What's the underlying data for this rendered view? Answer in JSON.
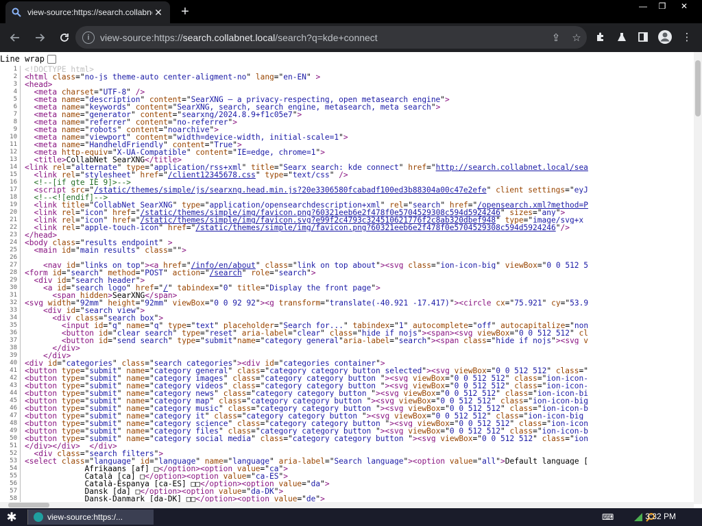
{
  "browser": {
    "tab_title": "view-source:https://search.collabnet...",
    "url_scheme": "view-source:https://",
    "url_host": "search.collabnet.local",
    "url_path": "/search?q=kde+connect",
    "url_full": "view-source:https://search.collabnet.local/search?q=kde+connect"
  },
  "line_wrap_label": "Line wrap",
  "source_lines": [
    {
      "n": "1",
      "html": "<span class='t-doc'>&lt;!DOCTYPE html&gt;</span>"
    },
    {
      "n": "2",
      "html": "<span class='t-tag'>&lt;html</span> <span class='t-attr'>class</span>=\"<span class='t-val'>no-js theme-auto center-aligment-no</span>\" <span class='t-attr'>lang</span>=\"<span class='t-val'>en-EN</span>\" <span class='t-tag'>&gt;</span>"
    },
    {
      "n": "3",
      "html": "<span class='t-tag'>&lt;head&gt;</span>"
    },
    {
      "n": "4",
      "html": "  <span class='t-tag'>&lt;meta</span> <span class='t-attr'>charset</span>=\"<span class='t-val'>UTF-8</span>\" <span class='t-tag'>/&gt;</span>"
    },
    {
      "n": "5",
      "html": "  <span class='t-tag'>&lt;meta</span> <span class='t-attr'>name</span>=\"<span class='t-val'>description</span>\" <span class='t-attr'>content</span>=\"<span class='t-val'>SearXNG — a privacy-respecting, open metasearch engine</span>\"<span class='t-tag'>&gt;</span>"
    },
    {
      "n": "6",
      "html": "  <span class='t-tag'>&lt;meta</span> <span class='t-attr'>name</span>=\"<span class='t-val'>keywords</span>\" <span class='t-attr'>content</span>=\"<span class='t-val'>SearXNG, search, search engine, metasearch, meta search</span>\"<span class='t-tag'>&gt;</span>"
    },
    {
      "n": "7",
      "html": "  <span class='t-tag'>&lt;meta</span> <span class='t-attr'>name</span>=\"<span class='t-val'>generator</span>\" <span class='t-attr'>content</span>=\"<span class='t-val'>searxng/2024.8.9+f1c05e7</span>\"<span class='t-tag'>&gt;</span>"
    },
    {
      "n": "8",
      "html": "  <span class='t-tag'>&lt;meta</span> <span class='t-attr'>name</span>=\"<span class='t-val'>referrer</span>\" <span class='t-attr'>content</span>=\"<span class='t-val'>no-referrer</span>\"<span class='t-tag'>&gt;</span>"
    },
    {
      "n": "9",
      "html": "  <span class='t-tag'>&lt;meta</span> <span class='t-attr'>name</span>=\"<span class='t-val'>robots</span>\" <span class='t-attr'>content</span>=\"<span class='t-val'>noarchive</span>\"<span class='t-tag'>&gt;</span>"
    },
    {
      "n": "10",
      "html": "  <span class='t-tag'>&lt;meta</span> <span class='t-attr'>name</span>=\"<span class='t-val'>viewport</span>\" <span class='t-attr'>content</span>=\"<span class='t-val'>width=device-width, initial-scale=1</span>\"<span class='t-tag'>&gt;</span>"
    },
    {
      "n": "11",
      "html": "  <span class='t-tag'>&lt;meta</span> <span class='t-attr'>name</span>=\"<span class='t-val'>HandheldFriendly</span>\" <span class='t-attr'>content</span>=\"<span class='t-val'>True</span>\"<span class='t-tag'>&gt;</span>"
    },
    {
      "n": "12",
      "html": "  <span class='t-tag'>&lt;meta</span> <span class='t-attr'>http-equiv</span>=\"<span class='t-val'>X-UA-Compatible</span>\" <span class='t-attr'>content</span>=\"<span class='t-val'>IE=edge, chrome=1</span>\"<span class='t-tag'>&gt;</span>"
    },
    {
      "n": "13",
      "html": "  <span class='t-tag'>&lt;title&gt;</span>CollabNet SearXNG<span class='t-tag'>&lt;/title&gt;</span>"
    },
    {
      "n": "14",
      "html": "<span class='t-tag'>&lt;link</span> <span class='t-attr'>rel</span>=\"<span class='t-val'>alternate</span>\" <span class='t-attr'>type</span>=\"<span class='t-val'>application/rss+xml</span>\" <span class='t-attr'>title</span>=\"<span class='t-val'>Searx search: kde connect</span>\" <span class='t-attr'>href</span>=\"<span class='t-link'>http://search.collabnet.local/sea</span>"
    },
    {
      "n": "15",
      "html": "  <span class='t-tag'>&lt;link</span> <span class='t-attr'>rel</span>=\"<span class='t-val'>stylesheet</span>\" <span class='t-attr'>href</span>=\"<span class='t-link'>/client12345678.css</span>\" <span class='t-attr'>type</span>=\"<span class='t-val'>text/css</span>\" <span class='t-tag'>/&gt;</span>"
    },
    {
      "n": "16",
      "html": "  <span class='t-com'>&lt;!--[if gte IE 9]&gt;--&gt;</span>"
    },
    {
      "n": "17",
      "html": "  <span class='t-tag'>&lt;script</span> <span class='t-attr'>src</span>=\"<span class='t-link'>/static/themes/simple/js/searxng.head.min.js?20e3306580fcabadf100ed3b88304a00c47e2efe</span>\" <span class='t-attr'>client_settings</span>=\"<span class='t-val'>eyJ</span>"
    },
    {
      "n": "18",
      "html": "  <span class='t-com'>&lt;!--&lt;![endif]--&gt;</span>"
    },
    {
      "n": "19",
      "html": "  <span class='t-tag'>&lt;link</span> <span class='t-attr'>title</span>=\"<span class='t-val'>CollabNet SearXNG</span>\" <span class='t-attr'>type</span>=\"<span class='t-val'>application/opensearchdescription+xml</span>\" <span class='t-attr'>rel</span>=\"<span class='t-val'>search</span>\" <span class='t-attr'>href</span>=\"<span class='t-link'>/opensearch.xml?method=P</span>"
    },
    {
      "n": "20",
      "html": "  <span class='t-tag'>&lt;link</span> <span class='t-attr'>rel</span>=\"<span class='t-val'>icon</span>\" <span class='t-attr'>href</span>=\"<span class='t-link'>/static/themes/simple/img/favicon.png?60321eeb6e2f478f0e5704529308c594d5924246</span>\" <span class='t-attr'>sizes</span>=\"<span class='t-val'>any</span>\"<span class='t-tag'>&gt;</span>"
    },
    {
      "n": "21",
      "html": "  <span class='t-tag'>&lt;link</span> <span class='t-attr'>rel</span>=\"<span class='t-val'>icon</span>\" <span class='t-attr'>href</span>=\"<span class='t-link'>/static/themes/simple/img/favicon.svg?e99f2c4793c324510621776f2c8ab320dbef948</span>\" <span class='t-attr'>type</span>=\"<span class='t-val'>image/svg+x</span>"
    },
    {
      "n": "22",
      "html": "  <span class='t-tag'>&lt;link</span> <span class='t-attr'>rel</span>=\"<span class='t-val'>apple-touch-icon</span>\" <span class='t-attr'>href</span>=\"<span class='t-link'>/static/themes/simple/img/favicon.png?60321eeb6e2f478f0e5704529308c594d5924246</span>\"<span class='t-tag'>/&gt;</span>"
    },
    {
      "n": "23",
      "html": "<span class='t-tag'>&lt;/head&gt;</span>"
    },
    {
      "n": "24",
      "html": "<span class='t-tag'>&lt;body</span> <span class='t-attr'>class</span>=\"<span class='t-val'>results_endpoint</span>\" <span class='t-tag'>&gt;</span>"
    },
    {
      "n": "25",
      "html": "  <span class='t-tag'>&lt;main</span> <span class='t-attr'>id</span>=\"<span class='t-val'>main_results</span>\" <span class='t-attr'>class</span>=\"\"<span class='t-tag'>&gt;</span>"
    },
    {
      "n": "26",
      "html": ""
    },
    {
      "n": "27",
      "html": "    <span class='t-tag'>&lt;nav</span> <span class='t-attr'>id</span>=\"<span class='t-val'>links_on_top</span>\"<span class='t-tag'>&gt;&lt;a</span> <span class='t-attr'>href</span>=\"<span class='t-link'>/info/en/about</span>\" <span class='t-attr'>class</span>=\"<span class='t-val'>link_on_top_about</span>\"<span class='t-tag'>&gt;&lt;svg</span> <span class='t-attr'>class</span>=\"<span class='t-val'>ion-icon-big</span>\" <span class='t-attr'>viewBox</span>=\"<span class='t-val'>0 0 512 5</span>"
    },
    {
      "n": "28",
      "html": "<span class='t-tag'>&lt;form</span> <span class='t-attr'>id</span>=\"<span class='t-val'>search</span>\" <span class='t-attr'>method</span>=\"<span class='t-val'>POST</span>\" <span class='t-attr'>action</span>=\"<span class='t-link'>/search</span>\" <span class='t-attr'>role</span>=\"<span class='t-val'>search</span>\"<span class='t-tag'>&gt;</span>"
    },
    {
      "n": "29",
      "html": "  <span class='t-tag'>&lt;div</span> <span class='t-attr'>id</span>=\"<span class='t-val'>search_header</span>\"<span class='t-tag'>&gt;</span>"
    },
    {
      "n": "30",
      "html": "    <span class='t-tag'>&lt;a</span> <span class='t-attr'>id</span>=\"<span class='t-val'>search_logo</span>\" <span class='t-attr'>href</span>=\"<span class='t-link'>/</span>\" <span class='t-attr'>tabindex</span>=\"<span class='t-val'>0</span>\" <span class='t-attr'>title</span>=\"<span class='t-val'>Display the front page</span>\"<span class='t-tag'>&gt;</span>"
    },
    {
      "n": "31",
      "html": "      <span class='t-tag'>&lt;span</span> <span class='t-attr'>hidden</span><span class='t-tag'>&gt;</span>SearXNG<span class='t-tag'>&lt;/span&gt;</span>"
    },
    {
      "n": "32",
      "html": "<span class='t-tag'>&lt;svg</span> <span class='t-attr'>width</span>=\"<span class='t-val'>92mm</span>\" <span class='t-attr'>height</span>=\"<span class='t-val'>92mm</span>\" <span class='t-attr'>viewBox</span>=\"<span class='t-val'>0 0 92 92</span>\"<span class='t-tag'>&gt;&lt;g</span> <span class='t-attr'>transform</span>=\"<span class='t-val'>translate(-40.921 -17.417)</span>\"<span class='t-tag'>&gt;&lt;circle</span> <span class='t-attr'>cx</span>=\"<span class='t-val'>75.921</span>\" <span class='t-attr'>cy</span>=\"<span class='t-val'>53.9</span>"
    },
    {
      "n": "33",
      "html": "    <span class='t-tag'>&lt;div</span> <span class='t-attr'>id</span>=\"<span class='t-val'>search_view</span>\"<span class='t-tag'>&gt;</span>"
    },
    {
      "n": "34",
      "html": "      <span class='t-tag'>&lt;div</span> <span class='t-attr'>class</span>=\"<span class='t-val'>search_box</span>\"<span class='t-tag'>&gt;</span>"
    },
    {
      "n": "35",
      "html": "        <span class='t-tag'>&lt;input</span> <span class='t-attr'>id</span>=\"<span class='t-val'>q</span>\" <span class='t-attr'>name</span>=\"<span class='t-val'>q</span>\" <span class='t-attr'>type</span>=\"<span class='t-val'>text</span>\" <span class='t-attr'>placeholder</span>=\"<span class='t-val'>Search for...</span>\" <span class='t-attr'>tabindex</span>=\"<span class='t-val'>1</span>\" <span class='t-attr'>autocomplete</span>=\"<span class='t-val'>off</span>\" <span class='t-attr'>autocapitalize</span>=\"<span class='t-val'>non</span>"
    },
    {
      "n": "36",
      "html": "        <span class='t-tag'>&lt;button</span> <span class='t-attr'>id</span>=\"<span class='t-val'>clear_search</span>\" <span class='t-attr'>type</span>=\"<span class='t-val'>reset</span>\" <span class='t-attr'>aria-label</span>=\"<span class='t-val'>clear</span>\" <span class='t-attr'>class</span>=\"<span class='t-val'>hide_if_nojs</span>\"<span class='t-tag'>&gt;&lt;span&gt;&lt;svg</span> <span class='t-attr'>viewBox</span>=\"<span class='t-val'>0 0 512 512</span>\" <span class='t-attr'>cl</span>"
    },
    {
      "n": "37",
      "html": "        <span class='t-tag'>&lt;button</span> <span class='t-attr'>id</span>=\"<span class='t-val'>send_search</span>\" <span class='t-attr'>type</span>=\"<span class='t-val'>submit</span>\"<span class='t-attr'>name</span>=\"<span class='t-val'>category_general</span>\"<span class='t-attr'>aria-label</span>=\"<span class='t-val'>search</span>\"<span class='t-tag'>&gt;&lt;span</span> <span class='t-attr'>class</span>=\"<span class='t-val'>hide_if_nojs</span>\"<span class='t-tag'>&gt;&lt;svg</span> <span class='t-attr'>v</span>"
    },
    {
      "n": "38",
      "html": "      <span class='t-tag'>&lt;/div&gt;</span>"
    },
    {
      "n": "39",
      "html": "    <span class='t-tag'>&lt;/div&gt;</span>"
    },
    {
      "n": "40",
      "html": "<span class='t-tag'>&lt;div</span> <span class='t-attr'>id</span>=\"<span class='t-val'>categories</span>\" <span class='t-attr'>class</span>=\"<span class='t-val'>search_categories</span>\"<span class='t-tag'>&gt;&lt;div</span> <span class='t-attr'>id</span>=\"<span class='t-val'>categories_container</span>\"<span class='t-tag'>&gt;</span>"
    },
    {
      "n": "41",
      "html": "<span class='t-tag'>&lt;button</span> <span class='t-attr'>type</span>=\"<span class='t-val'>submit</span>\" <span class='t-attr'>name</span>=\"<span class='t-val'>category_general</span>\" <span class='t-attr'>class</span>=\"<span class='t-val'>category category_button selected</span>\"<span class='t-tag'>&gt;&lt;svg</span> <span class='t-attr'>viewBox</span>=\"<span class='t-val'>0 0 512 512</span>\" <span class='t-attr'>class</span>=\""
    },
    {
      "n": "42",
      "html": "<span class='t-tag'>&lt;button</span> <span class='t-attr'>type</span>=\"<span class='t-val'>submit</span>\" <span class='t-attr'>name</span>=\"<span class='t-val'>category_images</span>\" <span class='t-attr'>class</span>=\"<span class='t-val'>category category_button </span>\"<span class='t-tag'>&gt;&lt;svg</span> <span class='t-attr'>viewBox</span>=\"<span class='t-val'>0 0 512 512</span>\" <span class='t-attr'>class</span>=\"<span class='t-val'>ion-icon-</span>"
    },
    {
      "n": "43",
      "html": "<span class='t-tag'>&lt;button</span> <span class='t-attr'>type</span>=\"<span class='t-val'>submit</span>\" <span class='t-attr'>name</span>=\"<span class='t-val'>category_videos</span>\" <span class='t-attr'>class</span>=\"<span class='t-val'>category category_button </span>\"<span class='t-tag'>&gt;&lt;svg</span> <span class='t-attr'>viewBox</span>=\"<span class='t-val'>0 0 512 512</span>\" <span class='t-attr'>class</span>=\"<span class='t-val'>ion-icon-</span>"
    },
    {
      "n": "44",
      "html": "<span class='t-tag'>&lt;button</span> <span class='t-attr'>type</span>=\"<span class='t-val'>submit</span>\" <span class='t-attr'>name</span>=\"<span class='t-val'>category_news</span>\" <span class='t-attr'>class</span>=\"<span class='t-val'>category category_button </span>\"<span class='t-tag'>&gt;&lt;svg</span> <span class='t-attr'>viewBox</span>=\"<span class='t-val'>0 0 512 512</span>\" <span class='t-attr'>class</span>=\"<span class='t-val'>ion-icon-bi</span>"
    },
    {
      "n": "45",
      "html": "<span class='t-tag'>&lt;button</span> <span class='t-attr'>type</span>=\"<span class='t-val'>submit</span>\" <span class='t-attr'>name</span>=\"<span class='t-val'>category_map</span>\" <span class='t-attr'>class</span>=\"<span class='t-val'>category category_button </span>\"<span class='t-tag'>&gt;&lt;svg</span> <span class='t-attr'>viewBox</span>=\"<span class='t-val'>0 0 512 512</span>\" <span class='t-attr'>class</span>=\"<span class='t-val'>ion-icon-big</span>"
    },
    {
      "n": "46",
      "html": "<span class='t-tag'>&lt;button</span> <span class='t-attr'>type</span>=\"<span class='t-val'>submit</span>\" <span class='t-attr'>name</span>=\"<span class='t-val'>category_music</span>\" <span class='t-attr'>class</span>=\"<span class='t-val'>category category_button </span>\"<span class='t-tag'>&gt;&lt;svg</span> <span class='t-attr'>viewBox</span>=\"<span class='t-val'>0 0 512 512</span>\" <span class='t-attr'>class</span>=\"<span class='t-val'>ion-icon-b</span>"
    },
    {
      "n": "47",
      "html": "<span class='t-tag'>&lt;button</span> <span class='t-attr'>type</span>=\"<span class='t-val'>submit</span>\" <span class='t-attr'>name</span>=\"<span class='t-val'>category_it</span>\" <span class='t-attr'>class</span>=\"<span class='t-val'>category category_button </span>\"<span class='t-tag'>&gt;&lt;svg</span> <span class='t-attr'>viewBox</span>=\"<span class='t-val'>0 0 512 512</span>\" <span class='t-attr'>class</span>=\"<span class='t-val'>ion-icon-big</span>"
    },
    {
      "n": "48",
      "html": "<span class='t-tag'>&lt;button</span> <span class='t-attr'>type</span>=\"<span class='t-val'>submit</span>\" <span class='t-attr'>name</span>=\"<span class='t-val'>category_science</span>\" <span class='t-attr'>class</span>=\"<span class='t-val'>category category_button </span>\"<span class='t-tag'>&gt;&lt;svg</span> <span class='t-attr'>viewBox</span>=\"<span class='t-val'>0 0 512 512</span>\" <span class='t-attr'>class</span>=\"<span class='t-val'>ion-icon</span>"
    },
    {
      "n": "49",
      "html": "<span class='t-tag'>&lt;button</span> <span class='t-attr'>type</span>=\"<span class='t-val'>submit</span>\" <span class='t-attr'>name</span>=\"<span class='t-val'>category_files</span>\" <span class='t-attr'>class</span>=\"<span class='t-val'>category category_button </span>\"<span class='t-tag'>&gt;&lt;svg</span> <span class='t-attr'>viewBox</span>=\"<span class='t-val'>0 0 512 512</span>\" <span class='t-attr'>class</span>=\"<span class='t-val'>ion-icon-b</span>"
    },
    {
      "n": "50",
      "html": "<span class='t-tag'>&lt;button</span> <span class='t-attr'>type</span>=\"<span class='t-val'>submit</span>\" <span class='t-attr'>name</span>=\"<span class='t-val'>category_social media</span>\" <span class='t-attr'>class</span>=\"<span class='t-val'>category category_button </span>\"<span class='t-tag'>&gt;&lt;svg</span> <span class='t-attr'>viewBox</span>=\"<span class='t-val'>0 0 512 512</span>\" <span class='t-attr'>class</span>=\"<span class='t-val'>ion</span>"
    },
    {
      "n": "51",
      "html": "<span class='t-tag'>&lt;/div&gt;&lt;/div&gt;</span>  <span class='t-tag'>&lt;/div&gt;</span>"
    },
    {
      "n": "52",
      "html": "  <span class='t-tag'>&lt;div</span> <span class='t-attr'>class</span>=\"<span class='t-val'>search_filters</span>\"<span class='t-tag'>&gt;</span>"
    },
    {
      "n": "53",
      "html": "<span class='t-tag'>&lt;select</span> <span class='t-attr'>class</span>=\"<span class='t-val'>language</span>\" <span class='t-attr'>id</span>=\"<span class='t-val'>language</span>\" <span class='t-attr'>name</span>=\"<span class='t-val'>language</span>\" <span class='t-attr'>aria-label</span>=\"<span class='t-val'>Search language</span>\"<span class='t-tag'>&gt;&lt;option</span> <span class='t-attr'>value</span>=\"<span class='t-val'>all</span>\"<span class='t-tag'>&gt;</span>Default language ["
    },
    {
      "n": "54",
      "html": "             Afrikaans [af] □<span class='t-tag'>&lt;/option&gt;&lt;option</span> <span class='t-attr'>value</span>=\"<span class='t-val'>ca</span>\"<span class='t-tag'>&gt;</span>"
    },
    {
      "n": "55",
      "html": "             Català [ca] □<span class='t-tag'>&lt;/option&gt;&lt;option</span> <span class='t-attr'>value</span>=\"<span class='t-val'>ca-ES</span>\"<span class='t-tag'>&gt;</span>"
    },
    {
      "n": "56",
      "html": "             Català-Espanya [ca-ES] □□<span class='t-tag'>&lt;/option&gt;&lt;option</span> <span class='t-attr'>value</span>=\"<span class='t-val'>da</span>\"<span class='t-tag'>&gt;</span>"
    },
    {
      "n": "57",
      "html": "             Dansk [da] □<span class='t-tag'>&lt;/option&gt;&lt;option</span> <span class='t-attr'>value</span>=\"<span class='t-val'>da-DK</span>\"<span class='t-tag'>&gt;</span>"
    },
    {
      "n": "58",
      "html": "             Dansk-Danmark [da-DK] □□<span class='t-tag'>&lt;/option&gt;&lt;option</span> <span class='t-attr'>value</span>=\"<span class='t-val'>de</span>\"<span class='t-tag'>&gt;</span>"
    }
  ],
  "taskbar": {
    "task_label": "view-source:https:/...",
    "clock": "3:32 PM"
  },
  "colors": {
    "tab_bg": "#202124",
    "toolbar_bg": "#202124",
    "taskbar_bg": "#1a1c2a"
  }
}
